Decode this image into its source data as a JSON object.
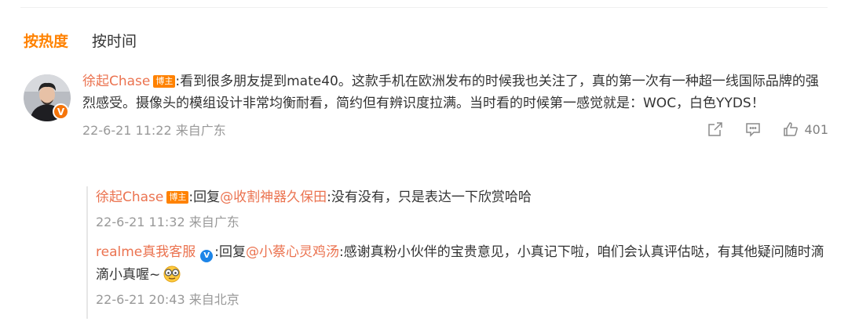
{
  "sort_tabs": [
    {
      "label": "按热度",
      "active": true
    },
    {
      "label": "按时间",
      "active": false
    }
  ],
  "comment": {
    "user": "徐起Chase",
    "badge": "博主",
    "text": ":看到很多朋友提到mate40。这款手机在欧洲发布的时候我也关注了，真的第一次有一种超一线国际品牌的强烈感受。摄像头的模组设计非常均衡耐看，简约但有辨识度拉满。当时看的时候第一感觉就是：WOC，白色YYDS！",
    "meta": "22-6-21 11:22 来自广东",
    "like_count": "401",
    "icons": [
      "share-icon",
      "comment-icon",
      "like-icon"
    ]
  },
  "replies": [
    {
      "user": "徐起Chase",
      "badge": "博主",
      "prefix": ":回复",
      "mention": "@收割神器久保田",
      "text": ":没有没有，只是表达一下欣赏哈哈",
      "meta": "22-6-21 11:32 来自广东"
    },
    {
      "user": "realme真我客服",
      "verified": "V",
      "prefix": ":回复",
      "mention": "@小蔡心灵鸡汤",
      "text": ":感谢真粉小伙伴的宝贵意见，小真记下啦，咱们会认真评估哒，有其他疑问随时滴滴小真喔~",
      "emoji": "emoji-icon",
      "meta": "22-6-21 20:43 来自北京"
    }
  ],
  "colors": {
    "accent": "#ff8200",
    "username": "#eb7350",
    "meta": "#999999",
    "verified_blue": "#1d85e8"
  }
}
